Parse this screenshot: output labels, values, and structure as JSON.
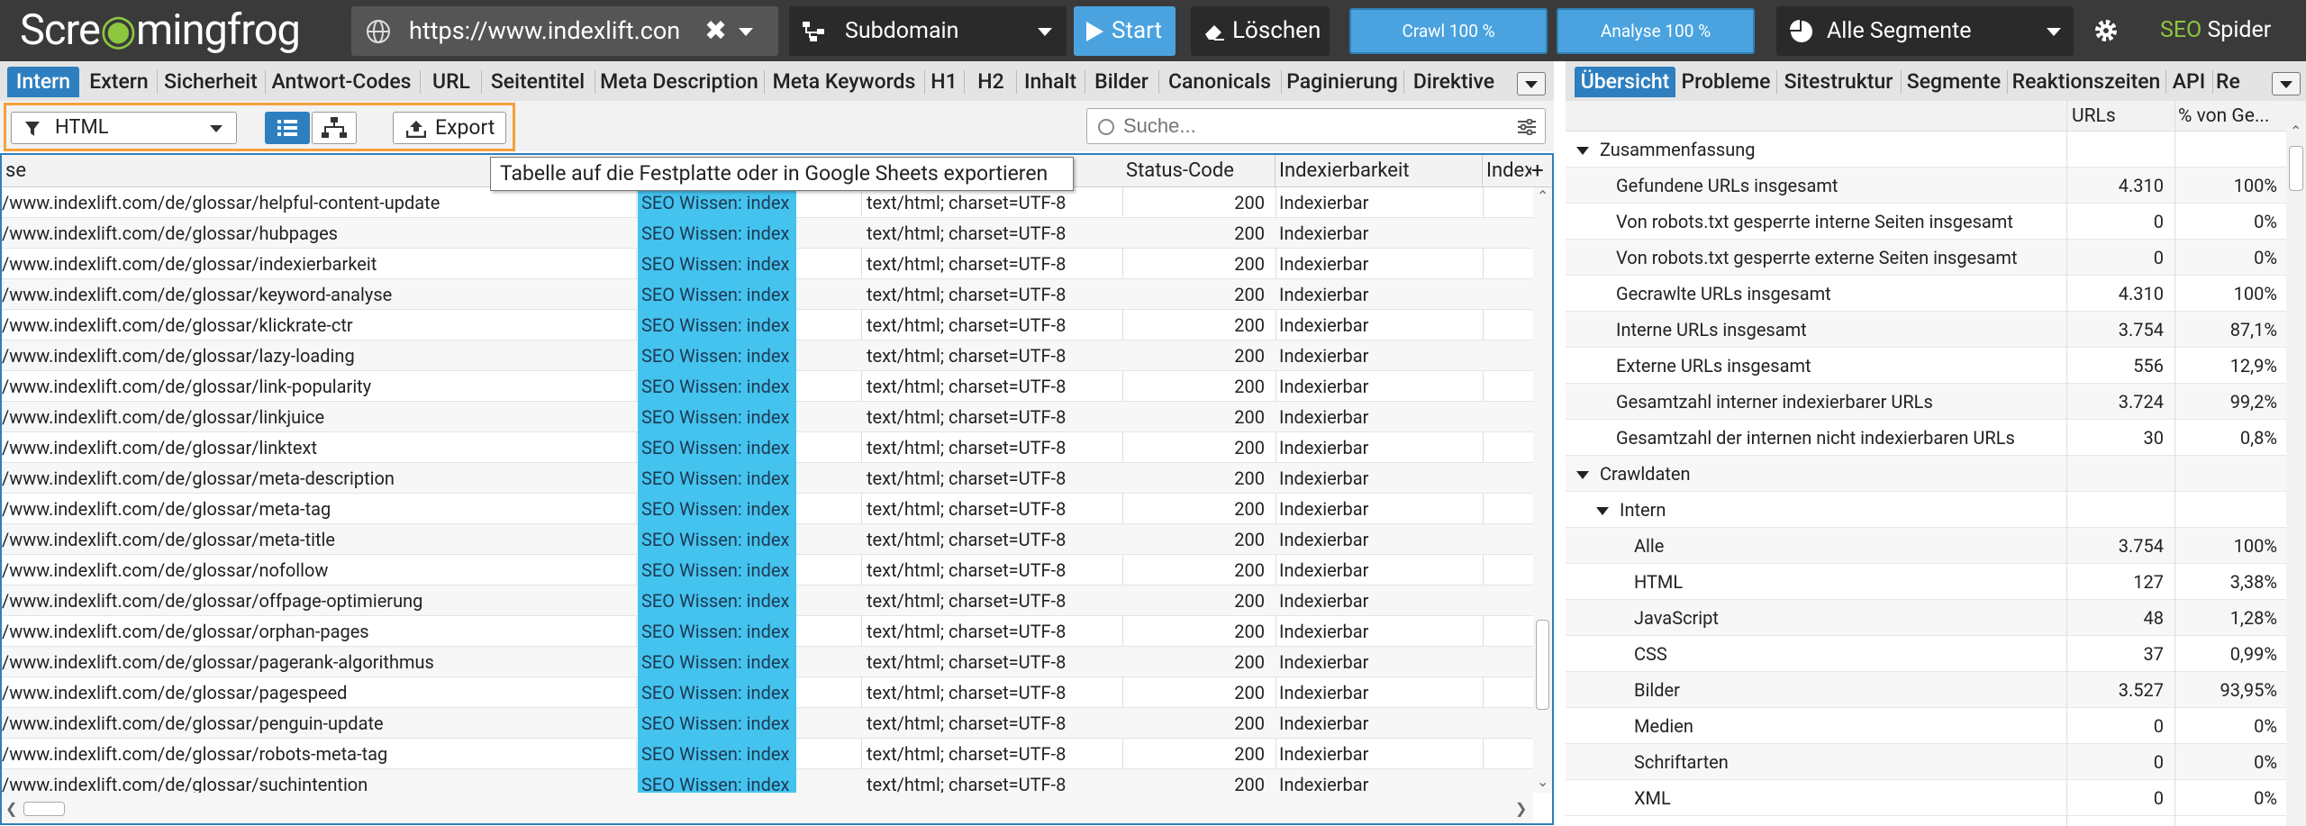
{
  "app": {
    "logo": {
      "pre": "Scre",
      "mid": "",
      "post": "mingfrog"
    },
    "brand": {
      "seo": "SEO",
      "spider": " Spider"
    },
    "url": "https://www.indexlift.con",
    "mode": "Subdomain",
    "start": "Start",
    "clear": "Löschen",
    "crawl": "Crawl 100 %",
    "analyse": "Analyse 100 %",
    "segments": "Alle Segmente"
  },
  "left_tabs": [
    "Intern",
    "Extern",
    "Sicherheit",
    "Antwort-Codes",
    "URL",
    "Seitentitel",
    "Meta Description",
    "Meta Keywords",
    "H1",
    "H2",
    "Inhalt",
    "Bilder",
    "Canonicals",
    "Paginierung",
    "Direktive"
  ],
  "right_tabs": [
    "Übersicht",
    "Probleme",
    "Sitestruktur",
    "Segmente",
    "Reaktionszeiten",
    "API",
    "Re"
  ],
  "toolbar": {
    "filter": "HTML",
    "export": "Export",
    "search_placeholder": "Suche...",
    "tooltip": "Tabelle auf die Festplatte oder in Google Sheets exportieren"
  },
  "grid": {
    "headers": [
      "se",
      "Status-Code",
      "Indexierbarkeit",
      "Indexe"
    ],
    "rows": [
      {
        "url": "/www.indexlift.com/de/glossar/helpful-content-update",
        "title": "SEO Wissen: index",
        "ct": "text/html; charset=UTF-8",
        "sc": "200",
        "idx": "Indexierbar"
      },
      {
        "url": "/www.indexlift.com/de/glossar/hubpages",
        "title": "SEO Wissen: index",
        "ct": "text/html; charset=UTF-8",
        "sc": "200",
        "idx": "Indexierbar"
      },
      {
        "url": "/www.indexlift.com/de/glossar/indexierbarkeit",
        "title": "SEO Wissen: index",
        "ct": "text/html; charset=UTF-8",
        "sc": "200",
        "idx": "Indexierbar"
      },
      {
        "url": "/www.indexlift.com/de/glossar/keyword-analyse",
        "title": "SEO Wissen: index",
        "ct": "text/html; charset=UTF-8",
        "sc": "200",
        "idx": "Indexierbar"
      },
      {
        "url": "/www.indexlift.com/de/glossar/klickrate-ctr",
        "title": "SEO Wissen: index",
        "ct": "text/html; charset=UTF-8",
        "sc": "200",
        "idx": "Indexierbar"
      },
      {
        "url": "/www.indexlift.com/de/glossar/lazy-loading",
        "title": "SEO Wissen: index",
        "ct": "text/html; charset=UTF-8",
        "sc": "200",
        "idx": "Indexierbar"
      },
      {
        "url": "/www.indexlift.com/de/glossar/link-popularity",
        "title": "SEO Wissen: index",
        "ct": "text/html; charset=UTF-8",
        "sc": "200",
        "idx": "Indexierbar"
      },
      {
        "url": "/www.indexlift.com/de/glossar/linkjuice",
        "title": "SEO Wissen: index",
        "ct": "text/html; charset=UTF-8",
        "sc": "200",
        "idx": "Indexierbar"
      },
      {
        "url": "/www.indexlift.com/de/glossar/linktext",
        "title": "SEO Wissen: index",
        "ct": "text/html; charset=UTF-8",
        "sc": "200",
        "idx": "Indexierbar"
      },
      {
        "url": "/www.indexlift.com/de/glossar/meta-description",
        "title": "SEO Wissen: index",
        "ct": "text/html; charset=UTF-8",
        "sc": "200",
        "idx": "Indexierbar"
      },
      {
        "url": "/www.indexlift.com/de/glossar/meta-tag",
        "title": "SEO Wissen: index",
        "ct": "text/html; charset=UTF-8",
        "sc": "200",
        "idx": "Indexierbar"
      },
      {
        "url": "/www.indexlift.com/de/glossar/meta-title",
        "title": "SEO Wissen: index",
        "ct": "text/html; charset=UTF-8",
        "sc": "200",
        "idx": "Indexierbar"
      },
      {
        "url": "/www.indexlift.com/de/glossar/nofollow",
        "title": "SEO Wissen: index",
        "ct": "text/html; charset=UTF-8",
        "sc": "200",
        "idx": "Indexierbar"
      },
      {
        "url": "/www.indexlift.com/de/glossar/offpage-optimierung",
        "title": "SEO Wissen: index",
        "ct": "text/html; charset=UTF-8",
        "sc": "200",
        "idx": "Indexierbar"
      },
      {
        "url": "/www.indexlift.com/de/glossar/orphan-pages",
        "title": "SEO Wissen: index",
        "ct": "text/html; charset=UTF-8",
        "sc": "200",
        "idx": "Indexierbar"
      },
      {
        "url": "/www.indexlift.com/de/glossar/pagerank-algorithmus",
        "title": "SEO Wissen: index",
        "ct": "text/html; charset=UTF-8",
        "sc": "200",
        "idx": "Indexierbar"
      },
      {
        "url": "/www.indexlift.com/de/glossar/pagespeed",
        "title": "SEO Wissen: index",
        "ct": "text/html; charset=UTF-8",
        "sc": "200",
        "idx": "Indexierbar"
      },
      {
        "url": "/www.indexlift.com/de/glossar/penguin-update",
        "title": "SEO Wissen: index",
        "ct": "text/html; charset=UTF-8",
        "sc": "200",
        "idx": "Indexierbar"
      },
      {
        "url": "/www.indexlift.com/de/glossar/robots-meta-tag",
        "title": "SEO Wissen: index",
        "ct": "text/html; charset=UTF-8",
        "sc": "200",
        "idx": "Indexierbar"
      },
      {
        "url": "/www.indexlift.com/de/glossar/suchintention",
        "title": "SEO Wissen: index",
        "ct": "text/html; charset=UTF-8",
        "sc": "200",
        "idx": "Indexierbar"
      }
    ]
  },
  "overview": {
    "col_urls": "URLs",
    "col_pct": "% von Ge...",
    "rows": [
      {
        "label": "Zusammenfassung",
        "n": "",
        "p": "",
        "level": 0,
        "group": true
      },
      {
        "label": "Gefundene URLs insgesamt",
        "n": "4.310",
        "p": "100%",
        "level": 1
      },
      {
        "label": "Von robots.txt gesperrte interne Seiten insgesamt",
        "n": "0",
        "p": "0%",
        "level": 1
      },
      {
        "label": "Von robots.txt gesperrte externe Seiten insgesamt",
        "n": "0",
        "p": "0%",
        "level": 1
      },
      {
        "label": "Gecrawlte URLs insgesamt",
        "n": "4.310",
        "p": "100%",
        "level": 1
      },
      {
        "label": "Interne URLs insgesamt",
        "n": "3.754",
        "p": "87,1%",
        "level": 1
      },
      {
        "label": "Externe URLs insgesamt",
        "n": "556",
        "p": "12,9%",
        "level": 1
      },
      {
        "label": "Gesamtzahl interner indexierbarer URLs",
        "n": "3.724",
        "p": "99,2%",
        "level": 1
      },
      {
        "label": "Gesamtzahl der internen nicht indexierbaren URLs",
        "n": "30",
        "p": "0,8%",
        "level": 1
      },
      {
        "label": "Crawldaten",
        "n": "",
        "p": "",
        "level": 0,
        "group": true
      },
      {
        "label": "Intern",
        "n": "",
        "p": "",
        "level": 1,
        "group": true
      },
      {
        "label": "Alle",
        "n": "3.754",
        "p": "100%",
        "level": 2
      },
      {
        "label": "HTML",
        "n": "127",
        "p": "3,38%",
        "level": 2
      },
      {
        "label": "JavaScript",
        "n": "48",
        "p": "1,28%",
        "level": 2
      },
      {
        "label": "CSS",
        "n": "37",
        "p": "0,99%",
        "level": 2
      },
      {
        "label": "Bilder",
        "n": "3.527",
        "p": "93,95%",
        "level": 2
      },
      {
        "label": "Medien",
        "n": "0",
        "p": "0%",
        "level": 2
      },
      {
        "label": "Schriftarten",
        "n": "0",
        "p": "0%",
        "level": 2
      },
      {
        "label": "XML",
        "n": "0",
        "p": "0%",
        "level": 2
      }
    ]
  },
  "colors": {
    "accent": "#2e7fbf",
    "highlight": "#f6a03d",
    "title_cell": "#44c3ee",
    "brand_green": "#8dc63f"
  }
}
